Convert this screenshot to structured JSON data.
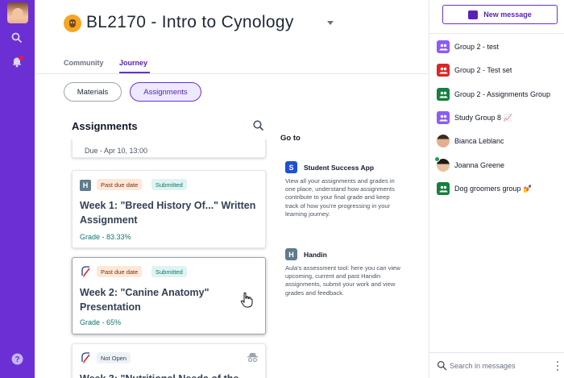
{
  "rail": {
    "icons": [
      "user-avatar",
      "search-icon",
      "bell-icon",
      "help-icon"
    ],
    "help_label": "?"
  },
  "course": {
    "title": "BL2170 - Intro to Cynology"
  },
  "tabs": [
    {
      "label": "Community",
      "active": false
    },
    {
      "label": "Journey",
      "active": true
    }
  ],
  "filters": {
    "materials": "Materials",
    "assignments": "Assignments"
  },
  "assignments": {
    "heading": "Assignments",
    "partial_due": "Due - Apr 10, 13:00",
    "items": [
      {
        "icon_letter": "H",
        "chip1": "Past due date",
        "chip2": "Submitted",
        "title": "Week 1: \"Breed History Of...\" Written Assignment",
        "grade": "Grade - 83.33%"
      },
      {
        "chip1": "Past due date",
        "chip2": "Submitted",
        "title": "Week 2: \"Canine Anatomy\" Presentation",
        "grade": "Grade - 65%"
      },
      {
        "chip1": "Not Open",
        "title": "Week 3: \"Nutritional Needs of the"
      }
    ]
  },
  "goto": {
    "heading": "Go to",
    "apps": [
      {
        "letter": "S",
        "name": "Student Success App",
        "desc": "View all your assignments and grades in one place, understand how assignments contribute to your final grade and keep track of how you're progressing in your learning journey.",
        "color": "#1d4ed8"
      },
      {
        "letter": "H",
        "name": "Handin",
        "desc": "Aula's assessment tool: here you can view upcoming, current and past Handin assignments, submit your work and view grades and feedback.",
        "color": "#5f7b8c"
      }
    ]
  },
  "messages": {
    "new_button": "New message",
    "conversations": [
      {
        "name": "Group 2 - test",
        "color": "#8b5cf6",
        "type": "group"
      },
      {
        "name": "Group 2 - Test set",
        "color": "#dc2626",
        "type": "group"
      },
      {
        "name": "Group 2 - Assignments Group",
        "color": "#15803d",
        "type": "group"
      },
      {
        "name": "Study Group 8 📈",
        "color": "#8b5cf6",
        "type": "group"
      },
      {
        "name": "Bianca Leblanc",
        "type": "person",
        "online": false
      },
      {
        "name": "Joanna Greene",
        "type": "person",
        "online": true
      },
      {
        "name": "Dog groomers group 💅",
        "color": "#15803d",
        "type": "group"
      }
    ],
    "search_placeholder": "Search in messages"
  },
  "colors": {
    "rail": "#6b2fd4",
    "accent": "#5b21b6",
    "grade": "#0f766e"
  }
}
